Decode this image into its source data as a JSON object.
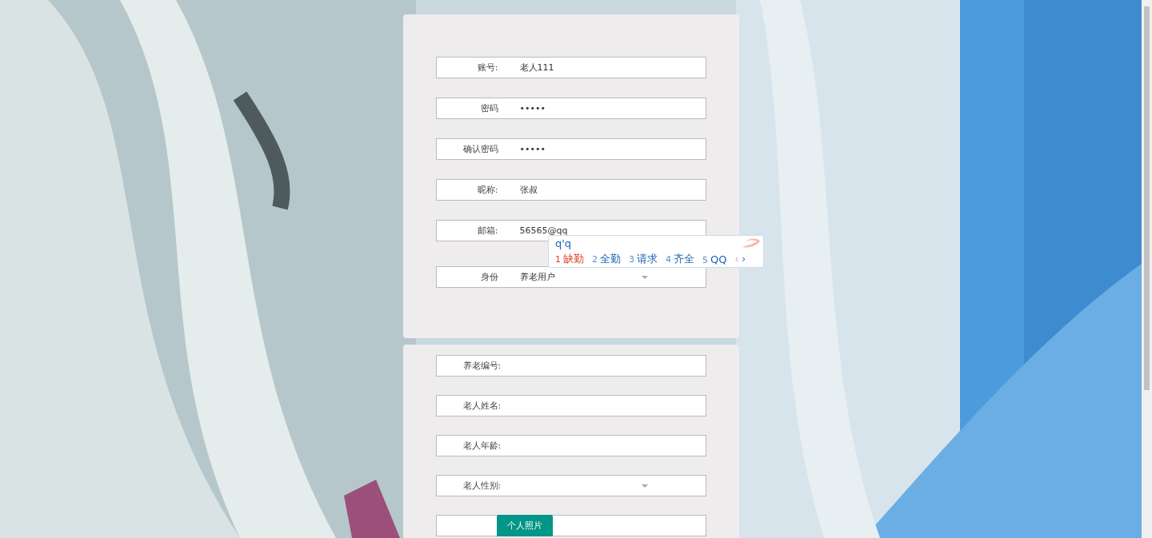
{
  "account_form": {
    "fields": [
      {
        "kind": "text",
        "label": "账号:",
        "value": "老人111"
      },
      {
        "kind": "text",
        "label": "密码",
        "value": "•••••"
      },
      {
        "kind": "text",
        "label": "确认密码",
        "value": "•••••"
      },
      {
        "kind": "text",
        "label": "昵称:",
        "value": "张叔"
      },
      {
        "kind": "text",
        "label": "邮箱:",
        "value": "56565@qq"
      },
      {
        "kind": "select",
        "label": "身份",
        "value": "养老用户"
      }
    ]
  },
  "elder_form": {
    "fields": [
      {
        "kind": "text",
        "label": "养老编号:"
      },
      {
        "kind": "text",
        "label": "老人姓名:"
      },
      {
        "kind": "text",
        "label": "老人年龄:"
      },
      {
        "kind": "select",
        "label": "老人性别:"
      },
      {
        "kind": "button",
        "label": "个人照片"
      }
    ]
  },
  "ime_popup": {
    "composition": "q'q",
    "candidates": [
      {
        "index": "1",
        "text": "缺勤",
        "selected": true
      },
      {
        "index": "2",
        "text": "全勤",
        "selected": false
      },
      {
        "index": "3",
        "text": "请求",
        "selected": false
      },
      {
        "index": "4",
        "text": "齐全",
        "selected": false
      },
      {
        "index": "5",
        "text": "QQ",
        "selected": false
      }
    ],
    "prev": "‹",
    "next": "›"
  }
}
